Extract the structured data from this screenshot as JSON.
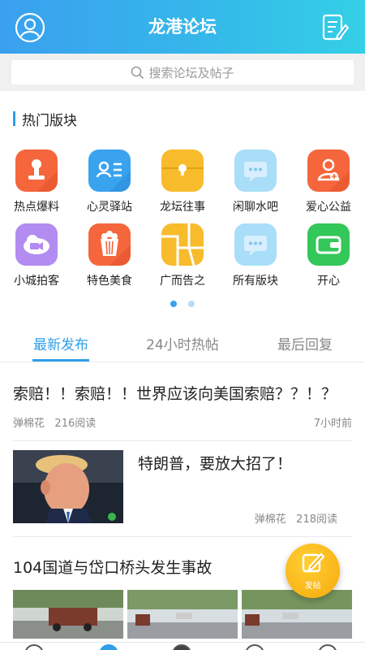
{
  "header": {
    "title": "龙港论坛",
    "left_icon": "user-icon",
    "right_icon": "edit-icon"
  },
  "search": {
    "placeholder": "搜索论坛及帖子",
    "icon": "search-icon"
  },
  "section": {
    "title": "热门版块"
  },
  "boards": [
    {
      "label": "热点爆料",
      "icon": "hotspot-icon",
      "color": "#f5663d"
    },
    {
      "label": "心灵驿站",
      "icon": "profile-card-icon",
      "color": "#3aa3ee"
    },
    {
      "label": "龙坛往事",
      "icon": "box-icon",
      "color": "#f7bb2c"
    },
    {
      "label": "闲聊水吧",
      "icon": "chat-icon",
      "color": "#a9def8"
    },
    {
      "label": "爱心公益",
      "icon": "user-add-icon",
      "color": "#f5663d"
    },
    {
      "label": "小城拍客",
      "icon": "video-icon",
      "color": "#b28cf0"
    },
    {
      "label": "特色美食",
      "icon": "popcorn-icon",
      "color": "#f5663d"
    },
    {
      "label": "广而告之",
      "icon": "map-icon",
      "color": "#f7bb2c"
    },
    {
      "label": "所有版块",
      "icon": "chat-icon",
      "color": "#a9def8"
    },
    {
      "label": "开心",
      "icon": "wallet-icon",
      "color": "#34c759"
    }
  ],
  "carousel": {
    "pages": 2,
    "active": 1
  },
  "tabs": [
    {
      "label": "最新发布",
      "active": true
    },
    {
      "label": "24小时热帖",
      "active": false
    },
    {
      "label": "最后回复",
      "active": false
    }
  ],
  "posts": [
    {
      "title": "索赔！！索赔！！世界应该向美国索赔？？！？",
      "author": "弹棉花",
      "reads": "216阅读",
      "time": "7小时前"
    },
    {
      "title": "特朗普，要放大招了！",
      "author": "弹棉花",
      "reads": "218阅读"
    },
    {
      "title": "104国道与岱口桥头发生事故"
    }
  ],
  "fab": {
    "label": "发帖",
    "icon": "edit-icon",
    "color": "#f7a90c"
  },
  "colors": {
    "accent": "#2f9fe8"
  }
}
